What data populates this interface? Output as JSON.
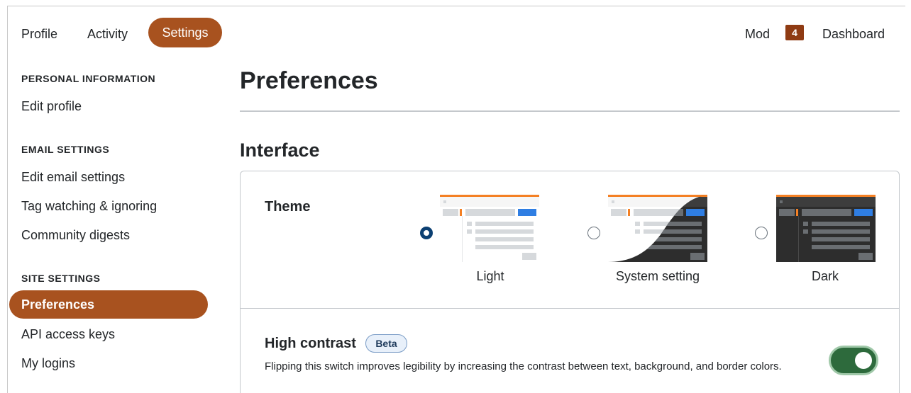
{
  "topnav": {
    "profile": "Profile",
    "activity": "Activity",
    "settings": "Settings",
    "mod": "Mod",
    "mod_count": "4",
    "dashboard": "Dashboard"
  },
  "sidebar": {
    "personal_heading": "PERSONAL INFORMATION",
    "edit_profile": "Edit profile",
    "email_heading": "EMAIL SETTINGS",
    "edit_email": "Edit email settings",
    "tag_watching": "Tag watching & ignoring",
    "community_digests": "Community digests",
    "site_heading": "SITE SETTINGS",
    "preferences": "Preferences",
    "api_keys": "API access keys",
    "my_logins": "My logins"
  },
  "main": {
    "page_title": "Preferences",
    "section_title": "Interface",
    "theme": {
      "label": "Theme",
      "options": [
        {
          "label": "Light",
          "selected": true
        },
        {
          "label": "System setting",
          "selected": false
        },
        {
          "label": "Dark",
          "selected": false
        }
      ]
    },
    "high_contrast": {
      "label": "High contrast",
      "badge": "Beta",
      "description": "Flipping this switch improves legibility by increasing the contrast between text, background, and border colors.",
      "enabled": true
    }
  },
  "colors": {
    "accent": "#a8521f",
    "badge": "#8f3b13",
    "radio_selected": "#0b3f72",
    "toggle_on": "#2d6a3c"
  }
}
